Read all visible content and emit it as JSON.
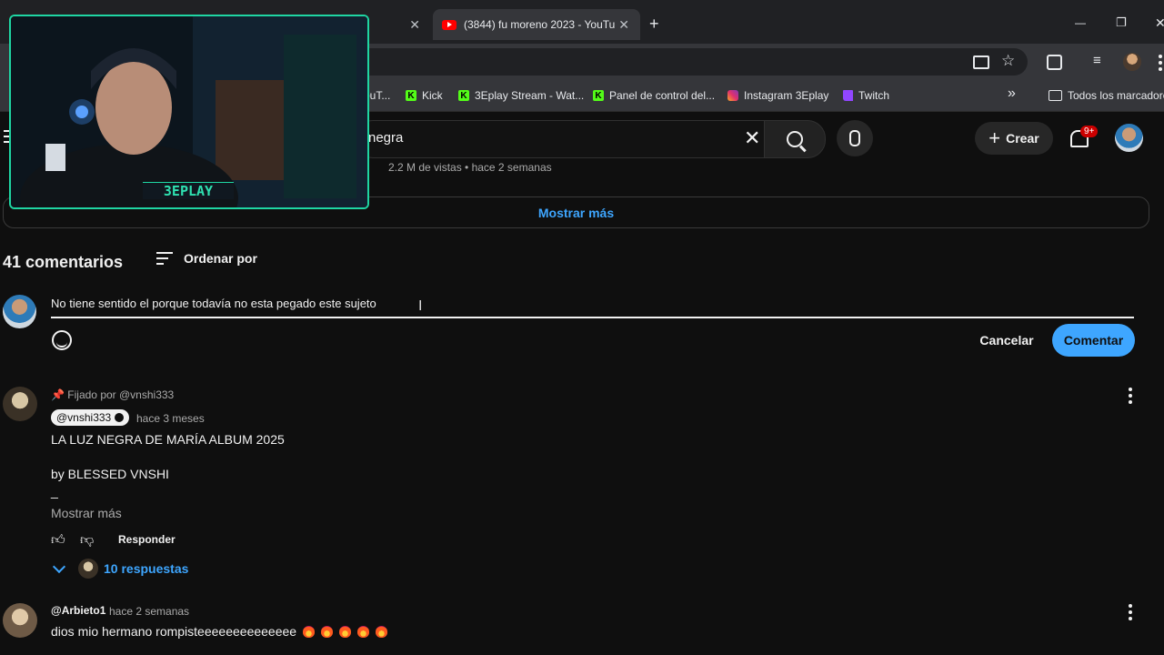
{
  "browser": {
    "tabs": [
      {
        "label": ""
      },
      {
        "label": "(3844) fu moreno 2023 - YouTu"
      }
    ],
    "new_tab_glyph": "+",
    "window_controls": {
      "minimize": "—",
      "maximize": "❐",
      "close": "✕"
    },
    "bookmarks": [
      {
        "label": "ouT...",
        "icon": "youtube-icon"
      },
      {
        "label": "Kick",
        "icon": "kick-icon"
      },
      {
        "label": "3Eplay Stream - Wat...",
        "icon": "kick-icon"
      },
      {
        "label": "Panel de control del...",
        "icon": "kick-icon"
      },
      {
        "label": "Instagram 3Eplay",
        "icon": "instagram-icon"
      },
      {
        "label": "Twitch",
        "icon": "twitch-icon"
      }
    ],
    "bookmarks_overflow": "»",
    "all_bookmarks": "Todos los marcadores"
  },
  "youtube": {
    "search_value": "negra",
    "create_label": "Crear",
    "notification_badge": "9+",
    "video_meta": "2.2 M de vistas • hace 2 semanas",
    "show_more": "Mostrar más"
  },
  "comments": {
    "count_label": "41 comentarios",
    "sort_label": "Ordenar por",
    "draft_text": "No tiene sentido el porque todavía no esta pegado este sujeto",
    "cancel_label": "Cancelar",
    "submit_label": "Comentar",
    "pinned": {
      "pinned_label": "Fijado por @vnshi333",
      "author": "@vnshi333",
      "time": "hace 3 meses",
      "line1": "LA LUZ NEGRA DE MARÍA ALBUM 2025",
      "line2": "by BLESSED VNSHI",
      "line3": "_",
      "read_more": "Mostrar más",
      "reply_label": "Responder",
      "replies_label": "10 respuestas"
    },
    "second": {
      "author": "@Arbieto1",
      "time": "hace 2 semanas",
      "text": "dios mio hermano rompisteeeeeeeeeeeeee"
    }
  },
  "overlay": {
    "brand": "3EPLAY"
  },
  "colors": {
    "accent_blue": "#3ea6ff",
    "notification_red": "#cc0000",
    "overlay_green": "#1fd6a3",
    "page_bg": "#0f0f0f"
  }
}
